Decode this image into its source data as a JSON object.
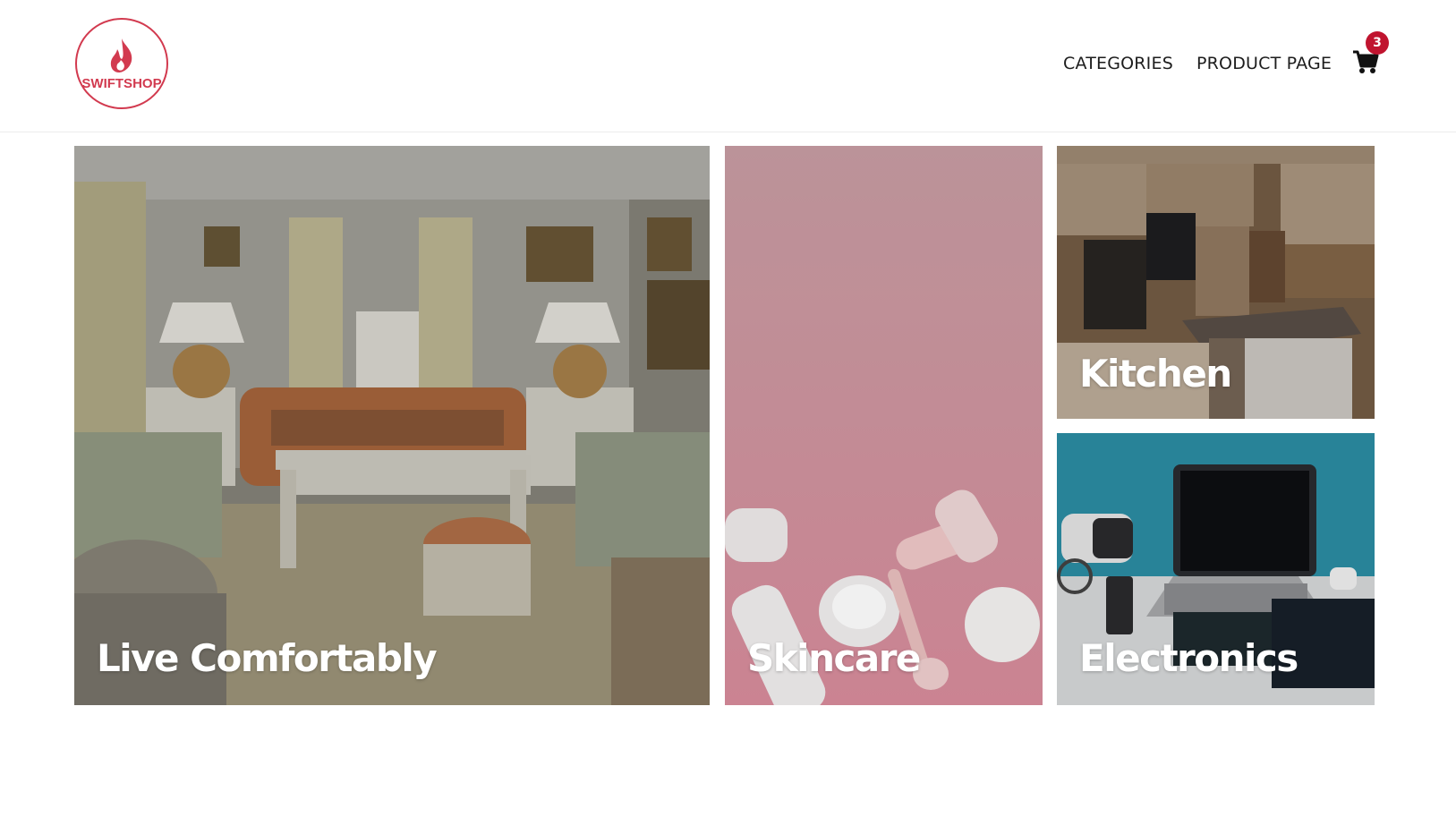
{
  "brand": {
    "name": "SWIFTSHOP",
    "accent_color": "#d23a4f",
    "logo_icon": "flame-icon"
  },
  "nav": {
    "categories_label": "CATEGORIES",
    "product_page_label": "PRODUCT PAGE",
    "cart_icon": "shopping-cart-icon",
    "cart_count": "3",
    "badge_color": "#c0142f"
  },
  "tiles": [
    {
      "label": "Live Comfortably",
      "image": "living-room-photo"
    },
    {
      "label": "Skincare",
      "image": "skincare-products-photo"
    },
    {
      "label": "Kitchen",
      "image": "modern-kitchen-photo"
    },
    {
      "label": "Electronics",
      "image": "laptop-desk-photo"
    }
  ]
}
